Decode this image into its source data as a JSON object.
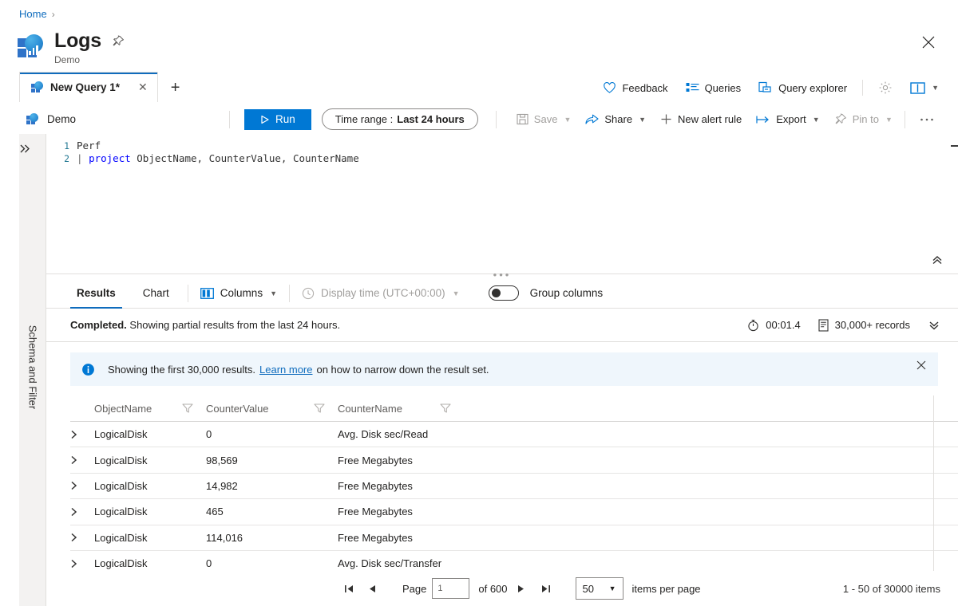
{
  "breadcrumb": {
    "home": "Home",
    "separator": "›"
  },
  "header": {
    "title": "Logs",
    "subtitle": "Demo",
    "pin_icon": "pin-icon",
    "more_icon": "ellipsis-icon",
    "close_icon": "close-icon"
  },
  "tabs": {
    "query_tab_label": "New Query 1*",
    "close_label": "✕",
    "add_label": "+"
  },
  "top_commands": [
    {
      "label": "Feedback",
      "icon": "heart-icon"
    },
    {
      "label": "Queries",
      "icon": "list-icon"
    },
    {
      "label": "Query explorer",
      "icon": "query-explorer-icon"
    }
  ],
  "top_commands_icons": {
    "settings": "gear-icon",
    "book": "book-icon",
    "chevron": "chevron-down-icon"
  },
  "toolbar": {
    "workspace": "Demo",
    "run_label": "Run",
    "run_icon": "play-icon",
    "time_range_label": "Time range :",
    "time_range_value": "Last 24 hours",
    "save_label": "Save",
    "share_label": "Share",
    "new_alert_label": "New alert rule",
    "export_label": "Export",
    "pin_to_label": "Pin to",
    "more_label": "···"
  },
  "rail": {
    "expand_icon": "double-chevron-right-icon",
    "vertical_label": "Schema and Filter"
  },
  "editor": {
    "lines": [
      {
        "num": "1",
        "tokens": [
          {
            "t": "Perf",
            "c": "plain"
          }
        ]
      },
      {
        "num": "2",
        "tokens": [
          {
            "t": "| ",
            "c": "pipe"
          },
          {
            "t": "project",
            "c": "kw"
          },
          {
            "t": " ObjectName, CounterValue, CounterName",
            "c": "plain"
          }
        ]
      }
    ],
    "collapse_icon": "double-chevron-up-icon"
  },
  "results_toolbar": {
    "tab_results": "Results",
    "tab_chart": "Chart",
    "columns_label": "Columns",
    "display_time_label": "Display time (UTC+00:00)",
    "group_columns_label": "Group columns",
    "group_columns_on": false
  },
  "status": {
    "message_bold": "Completed.",
    "message_rest": " Showing partial results from the last 24 hours.",
    "duration": "00:01.4",
    "records": "30,000+ records",
    "expand_icon": "double-chevron-down-icon"
  },
  "banner": {
    "text_before": "Showing the first 30,000 results.",
    "link": "Learn more",
    "text_after": "on how to narrow down the result set.",
    "info_icon": "info-icon",
    "close_icon": "close-icon"
  },
  "table": {
    "columns": [
      "ObjectName",
      "CounterValue",
      "CounterName"
    ],
    "filter_icon": "filter-icon",
    "expand_icon": "chevron-right-icon",
    "rows": [
      {
        "ObjectName": "LogicalDisk",
        "CounterValue": "0",
        "CounterName": "Avg. Disk sec/Read"
      },
      {
        "ObjectName": "LogicalDisk",
        "CounterValue": "98,569",
        "CounterName": "Free Megabytes"
      },
      {
        "ObjectName": "LogicalDisk",
        "CounterValue": "14,982",
        "CounterName": "Free Megabytes"
      },
      {
        "ObjectName": "LogicalDisk",
        "CounterValue": "465",
        "CounterName": "Free Megabytes"
      },
      {
        "ObjectName": "LogicalDisk",
        "CounterValue": "114,016",
        "CounterName": "Free Megabytes"
      },
      {
        "ObjectName": "LogicalDisk",
        "CounterValue": "0",
        "CounterName": "Avg. Disk sec/Transfer"
      }
    ]
  },
  "pager": {
    "first_icon": "first-page-icon",
    "prev_icon": "prev-page-icon",
    "page_label": "Page",
    "page_value": "1",
    "of_label": "of 600",
    "next_icon": "next-page-icon",
    "last_icon": "last-page-icon",
    "page_size": "50",
    "items_per_page_label": "items per page",
    "range_label": "1 - 50 of 30000 items"
  },
  "colors": {
    "accent": "#0078d4",
    "link": "#0f6cbd",
    "banner_bg": "#eff6fc",
    "rail_bg": "#f3f2f1"
  }
}
